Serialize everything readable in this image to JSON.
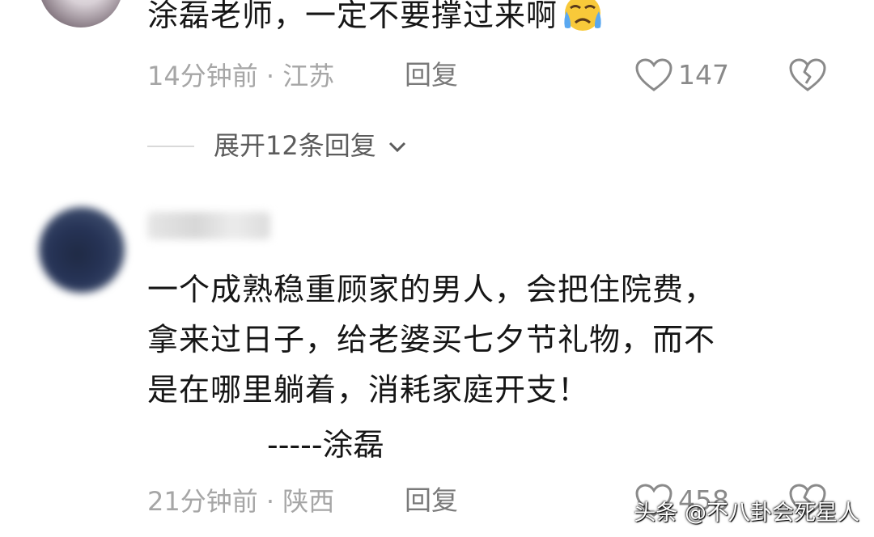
{
  "comment1": {
    "text": "涂磊老师，一定不要撑过来啊",
    "emoji_icon": "crying-face-emoji",
    "time_location": "14分钟前 · 江苏",
    "reply_label": "回复",
    "like_count": "147"
  },
  "expand": {
    "label": "展开12条回复"
  },
  "comment2": {
    "lines": [
      "一个成熟稳重顾家的男人，会把住院费，",
      "拿来过日子，给老婆买七夕节礼物，而不",
      "是在哪里躺着，消耗家庭开支！"
    ],
    "signature": "-----涂磊",
    "time_location": "21分钟前 · 陕西",
    "reply_label": "回复",
    "like_count": "458"
  },
  "watermark": "头条 @不八卦会死星人",
  "colors": {
    "text": "#161616",
    "meta": "#a6a6a6",
    "icon": "#8a8a8a"
  }
}
